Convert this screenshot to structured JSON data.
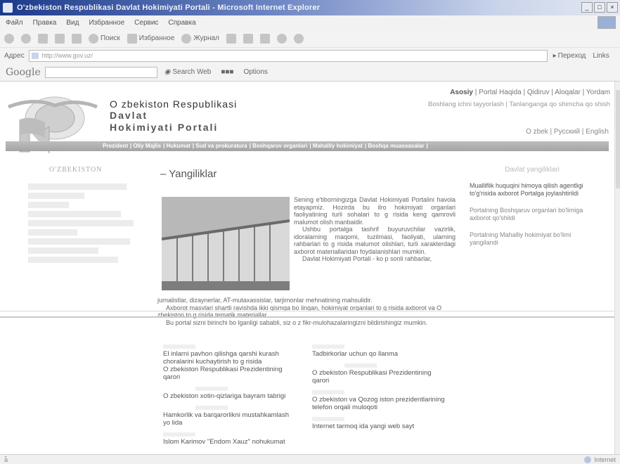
{
  "browser": {
    "title": "O'zbekiston Respublikasi Davlat Hokimiyati Portali - Microsoft Internet Explorer",
    "window_buttons": [
      "_",
      "□",
      "×"
    ],
    "menu": [
      "Файл",
      "Правка",
      "Вид",
      "Избранное",
      "Сервис",
      "Справка"
    ],
    "toolbar": {
      "search": "Поиск",
      "favorites": "Избранное",
      "journal": "Журнал"
    },
    "address": {
      "label": "Адрес",
      "url": "http://www.gov.uz/",
      "go": "Переход",
      "links": "Links"
    },
    "google": {
      "logo": "Google",
      "search_web": "Search Web",
      "options": "Options"
    },
    "status": {
      "left": "à̃",
      "zone": "Internet"
    }
  },
  "site": {
    "title_line1": "O zbekiston Respublikasi",
    "title_line2": "Davlat",
    "title_line3": "Hokimiyati Portali",
    "top_links": [
      "Asosiy",
      "Portal Haqida",
      "Qidiruv",
      "Aloqalar",
      "Yordam"
    ],
    "top_links2": [
      "Boshlang ichni tayyorlash",
      "Tanlanganga qo shimcha qo shish"
    ],
    "languages": [
      "O zbek",
      "Русский",
      "English"
    ],
    "nav": [
      "Prezident",
      "Oliy Majlis",
      "Hukumat",
      "Sud va prokuratura",
      "Boshqaruv organlari",
      "Mahalliy hokimiyat",
      "Boshqa muassasalar"
    ]
  },
  "left": {
    "title": "O'ZBEKISTON"
  },
  "main": {
    "section_title": "Yangiliklar",
    "lead": [
      "Sening e'tiborningizga Davlat Hokimiyati Portalini havola etayapmiz. Hozirda bu ilro hokimiyati organlari faoliyatining turli sohalari to g risida keng qamrovli malumot olish manbaidir.",
      "Ushbu portalga tashrif buyuruvchilar vazirlik, idoralarning maqomi, tuzilmasi, faoliyati, ularning rahbarlari to g risida malumot olishlari, turli xarakterdagi axborot materiallaridan foydalanishlari mumkin.",
      "Davlat Hokimiyati Portali - ko p sonli rahbarlar,"
    ],
    "full": [
      "jurnalistlar, dizaynerlar, AT-mutaxassislar, tarjimonlar mehnatining mahsulidir.",
      "Axborot masvlari shartli ravishda ikki qismga bo lingan, hokimiyat organlari to g risida axborot va O zbekiston to g risida tematik materiallar.",
      "Bu portal sizni birinchi bo lganligi sababli, siz o z fikr-mulohazalaringizni bildirishingiz mumkin."
    ]
  },
  "right": {
    "title": "Davlat yangiliklari",
    "items": [
      "Mualliflik huquqini himoya qilish agentligi to'g'risida axborot Portalga joylashtirildi",
      "Portalning Boshqaruv organlari bo'limiga axborot qo'shildi",
      "Portalning Mahalliy hokimiyat bo'limi yangilandi"
    ]
  },
  "news": {
    "left": [
      "El inlarni pavhon qilishga qarshi kurash choralarini kuchaytirish to g risida",
      "O zbekiston Respublikasi Prezidentining qarori",
      "O zbekiston xotin-qizlariga bayram tabrigi",
      "Hamkorlik va barqarorlikni mustahkamlash yo lida",
      "Islom Karimov \"Endom Xauz\" nohukumat"
    ],
    "right": [
      "Tadbirkorlar uchun qo llanma",
      "O zbekiston Respublikasi Prezidentining qarori",
      "O zbekiston va Qozog iston prezidentlarining telefon orqali muloqoti",
      "Internet tarmoq ida yangi web sayt"
    ]
  }
}
